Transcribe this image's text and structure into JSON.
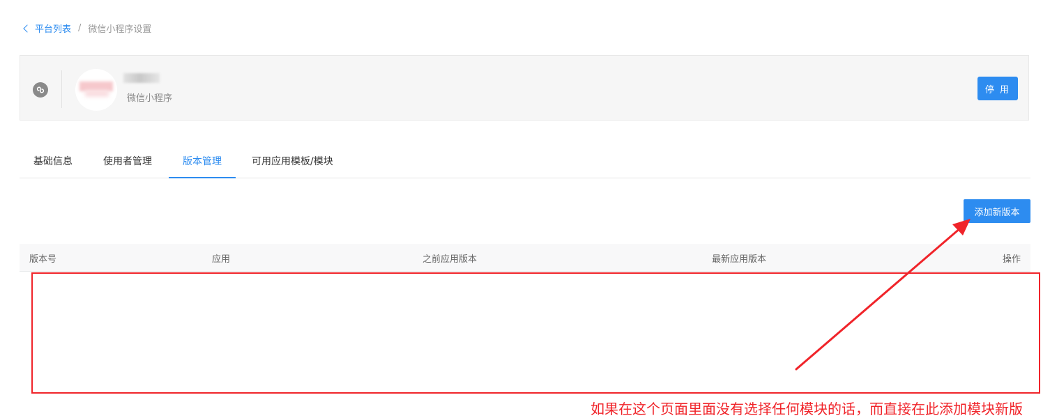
{
  "breadcrumb": {
    "back_label": "平台列表",
    "separator": "/",
    "current": "微信小程序设置"
  },
  "platform_card": {
    "app_type_label": "微信小程序",
    "disable_button": "停 用"
  },
  "tabs": [
    {
      "label": "基础信息",
      "active": false
    },
    {
      "label": "使用者管理",
      "active": false
    },
    {
      "label": "版本管理",
      "active": true
    },
    {
      "label": "可用应用模板/模块",
      "active": false
    }
  ],
  "toolbar": {
    "add_version_button": "添加新版本"
  },
  "table": {
    "columns": [
      "版本号",
      "应用",
      "之前应用版本",
      "最新应用版本",
      "操作"
    ],
    "rows": []
  },
  "annotation": {
    "text": "如果在这个页面里面没有选择任何模块的话，而直接在此添加模块新版",
    "color": "#f0242a"
  },
  "colors": {
    "accent": "#2d8cf0",
    "annotation_red": "#f0242a"
  }
}
